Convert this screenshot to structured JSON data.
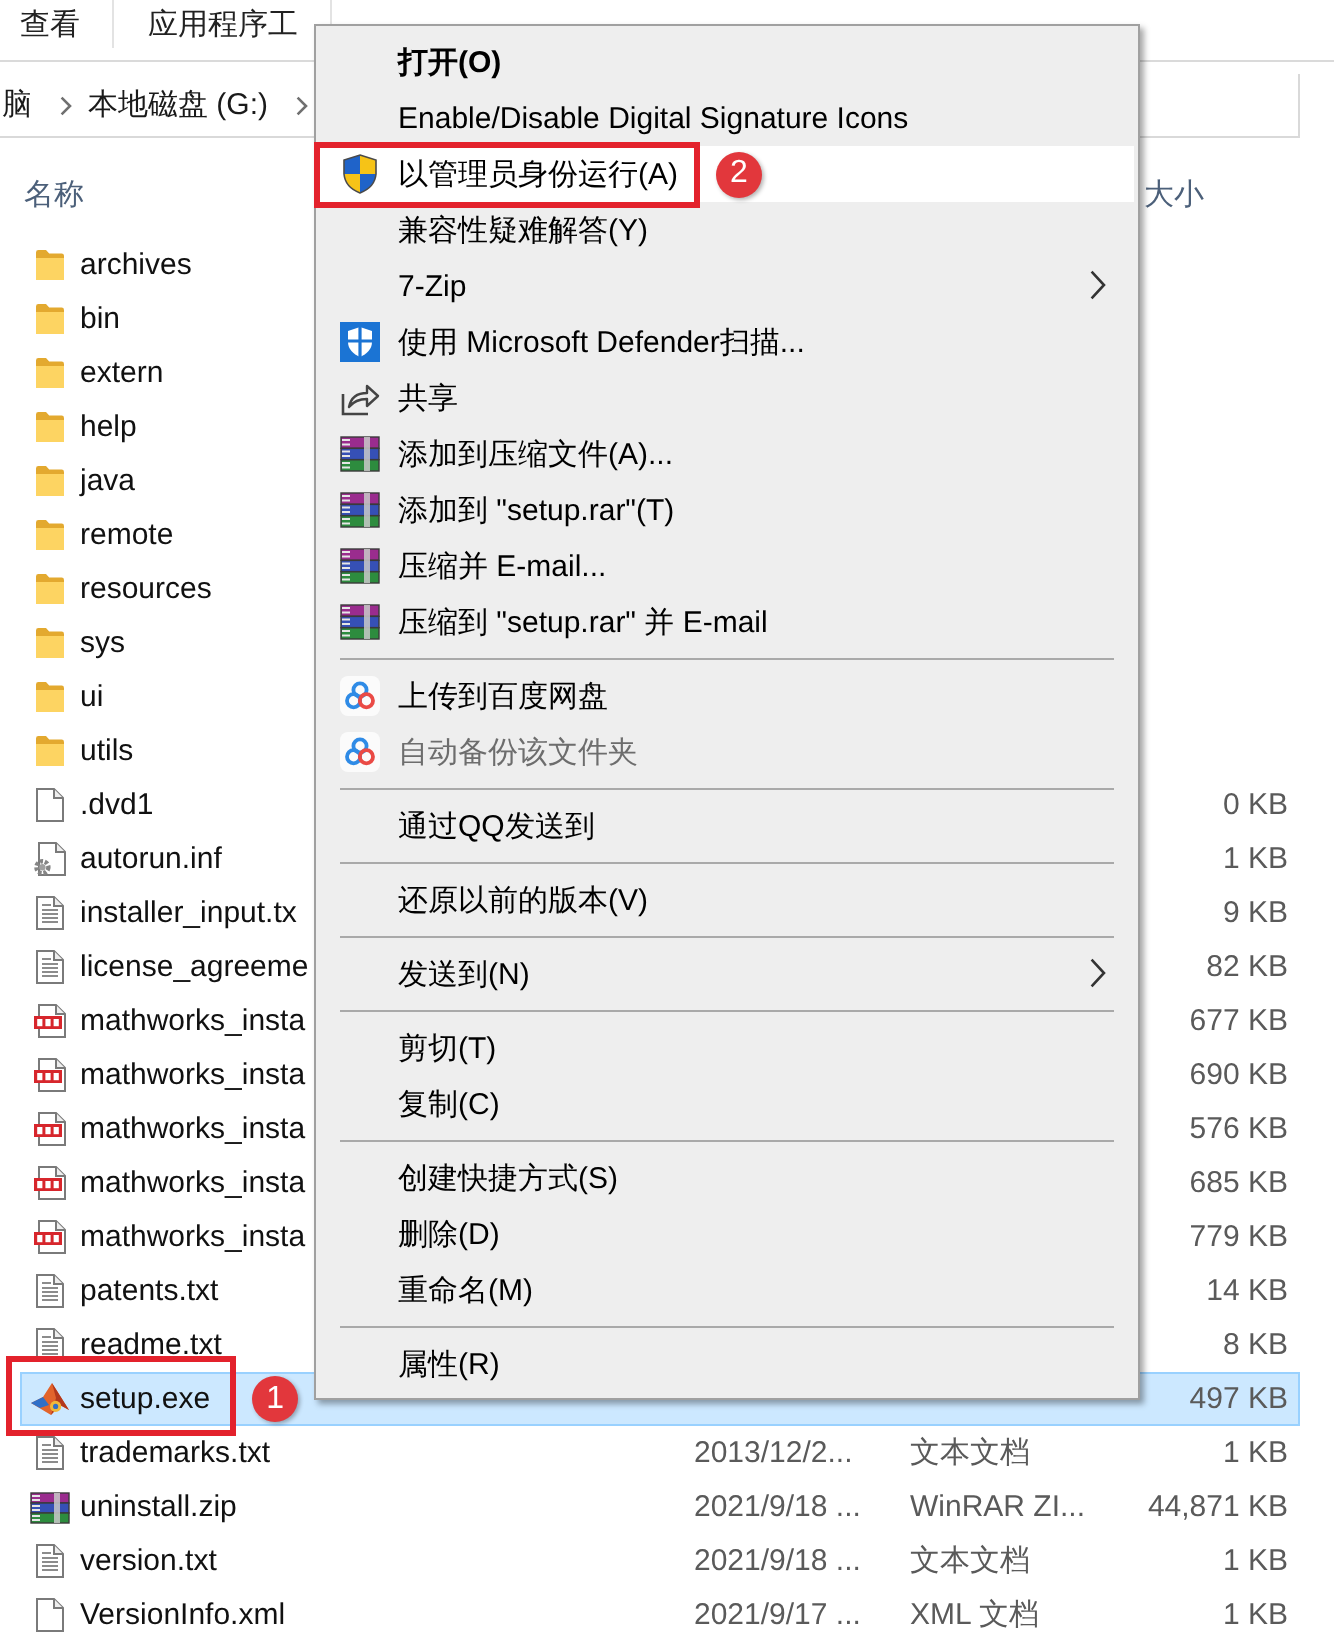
{
  "ribbon_tabs": [
    {
      "label": "查看"
    },
    {
      "label": "应用程序工"
    }
  ],
  "breadcrumb": [
    {
      "label": "脑"
    },
    {
      "label": "本地磁盘 (G:)"
    }
  ],
  "columns": [
    {
      "kind": "name",
      "label": "名称"
    },
    {
      "kind": "size",
      "label": "大小"
    }
  ],
  "files": [
    {
      "kind": "folder",
      "name": "archives",
      "selected": false
    },
    {
      "kind": "folder",
      "name": "bin",
      "selected": false
    },
    {
      "kind": "folder",
      "name": "extern",
      "selected": false
    },
    {
      "kind": "folder",
      "name": "help",
      "selected": false
    },
    {
      "kind": "folder",
      "name": "java",
      "selected": false
    },
    {
      "kind": "folder",
      "name": "remote",
      "selected": false
    },
    {
      "kind": "folder",
      "name": "resources",
      "selected": false
    },
    {
      "kind": "folder",
      "name": "sys",
      "selected": false
    },
    {
      "kind": "folder",
      "name": "ui",
      "selected": false
    },
    {
      "kind": "folder",
      "name": "utils",
      "selected": false
    },
    {
      "kind": "file",
      "name": ".dvd1",
      "size": "0 KB",
      "selected": false
    },
    {
      "kind": "config",
      "name": "autorun.inf",
      "size": "1 KB",
      "selected": false
    },
    {
      "kind": "text",
      "name": "installer_input.tx",
      "size": "9 KB",
      "selected": false
    },
    {
      "kind": "text",
      "name": "license_agreeme",
      "size": "82 KB",
      "selected": false
    },
    {
      "kind": "pdf",
      "name": "mathworks_insta",
      "size": "677 KB",
      "selected": false
    },
    {
      "kind": "pdf",
      "name": "mathworks_insta",
      "size": "690 KB",
      "selected": false
    },
    {
      "kind": "pdf",
      "name": "mathworks_insta",
      "size": "576 KB",
      "selected": false
    },
    {
      "kind": "pdf",
      "name": "mathworks_insta",
      "size": "685 KB",
      "selected": false
    },
    {
      "kind": "pdf",
      "name": "mathworks_insta",
      "size": "779 KB",
      "selected": false
    },
    {
      "kind": "text",
      "name": "patents.txt",
      "size": "14 KB",
      "selected": false
    },
    {
      "kind": "text",
      "name": "readme.txt",
      "size": "8 KB",
      "selected": false
    },
    {
      "kind": "app",
      "name": "setup.exe",
      "size": "497 KB",
      "selected": true,
      "callout": "1"
    },
    {
      "kind": "text",
      "name": "trademarks.txt",
      "date": "2013/12/2...",
      "type": "文本文档",
      "size": "1 KB",
      "selected": false
    },
    {
      "kind": "archive",
      "name": "uninstall.zip",
      "date": "2021/9/18 ...",
      "type": "WinRAR ZI...",
      "size": "44,871 KB",
      "selected": false
    },
    {
      "kind": "text",
      "name": "version.txt",
      "date": "2021/9/18 ...",
      "type": "文本文档",
      "size": "1 KB",
      "selected": false
    },
    {
      "kind": "file",
      "name": "VersionInfo.xml",
      "date": "2021/9/17 ...",
      "type": "XML 文档",
      "size": "1 KB",
      "selected": false
    }
  ],
  "context_menu": {
    "items": [
      {
        "kind": "plain",
        "label": "打开(O)",
        "default": true,
        "highlighted": false,
        "disabled": false,
        "submenu": false
      },
      {
        "kind": "plain",
        "label": "Enable/Disable Digital Signature Icons",
        "default": false,
        "highlighted": false,
        "disabled": false,
        "submenu": false
      },
      {
        "kind": "shield",
        "label": "以管理员身份运行(A)",
        "default": false,
        "highlighted": true,
        "disabled": false,
        "submenu": false,
        "callout": "2"
      },
      {
        "kind": "plain",
        "label": "兼容性疑难解答(Y)",
        "default": false,
        "highlighted": false,
        "disabled": false,
        "submenu": false
      },
      {
        "kind": "plain",
        "label": "7-Zip",
        "default": false,
        "highlighted": false,
        "disabled": false,
        "submenu": true
      },
      {
        "kind": "defender",
        "label": "使用 Microsoft Defender扫描...",
        "default": false,
        "highlighted": false,
        "disabled": false,
        "submenu": false
      },
      {
        "kind": "share",
        "label": "共享",
        "default": false,
        "highlighted": false,
        "disabled": false,
        "submenu": false
      },
      {
        "kind": "archive",
        "label": "添加到压缩文件(A)...",
        "default": false,
        "highlighted": false,
        "disabled": false,
        "submenu": false
      },
      {
        "kind": "archive",
        "label": "添加到 \"setup.rar\"(T)",
        "default": false,
        "highlighted": false,
        "disabled": false,
        "submenu": false
      },
      {
        "kind": "archive",
        "label": "压缩并 E-mail...",
        "default": false,
        "highlighted": false,
        "disabled": false,
        "submenu": false
      },
      {
        "kind": "archive",
        "label": "压缩到 \"setup.rar\" 并 E-mail",
        "default": false,
        "highlighted": false,
        "disabled": false,
        "submenu": false
      },
      {
        "kind": "separator"
      },
      {
        "kind": "cloud",
        "label": "上传到百度网盘",
        "default": false,
        "highlighted": false,
        "disabled": false,
        "submenu": false
      },
      {
        "kind": "cloud",
        "label": "自动备份该文件夹",
        "default": false,
        "highlighted": false,
        "disabled": true,
        "submenu": false
      },
      {
        "kind": "separator"
      },
      {
        "kind": "plain",
        "label": "通过QQ发送到",
        "default": false,
        "highlighted": false,
        "disabled": false,
        "submenu": false
      },
      {
        "kind": "separator"
      },
      {
        "kind": "plain",
        "label": "还原以前的版本(V)",
        "default": false,
        "highlighted": false,
        "disabled": false,
        "submenu": false
      },
      {
        "kind": "separator"
      },
      {
        "kind": "plain",
        "label": "发送到(N)",
        "default": false,
        "highlighted": false,
        "disabled": false,
        "submenu": true
      },
      {
        "kind": "separator"
      },
      {
        "kind": "plain",
        "label": "剪切(T)",
        "default": false,
        "highlighted": false,
        "disabled": false,
        "submenu": false
      },
      {
        "kind": "plain",
        "label": "复制(C)",
        "default": false,
        "highlighted": false,
        "disabled": false,
        "submenu": false
      },
      {
        "kind": "separator"
      },
      {
        "kind": "plain",
        "label": "创建快捷方式(S)",
        "default": false,
        "highlighted": false,
        "disabled": false,
        "submenu": false
      },
      {
        "kind": "plain",
        "label": "删除(D)",
        "default": false,
        "highlighted": false,
        "disabled": false,
        "submenu": false
      },
      {
        "kind": "plain",
        "label": "重命名(M)",
        "default": false,
        "highlighted": false,
        "disabled": false,
        "submenu": false
      },
      {
        "kind": "separator"
      },
      {
        "kind": "plain",
        "label": "属性(R)",
        "default": false,
        "highlighted": false,
        "disabled": false,
        "submenu": false
      }
    ]
  }
}
